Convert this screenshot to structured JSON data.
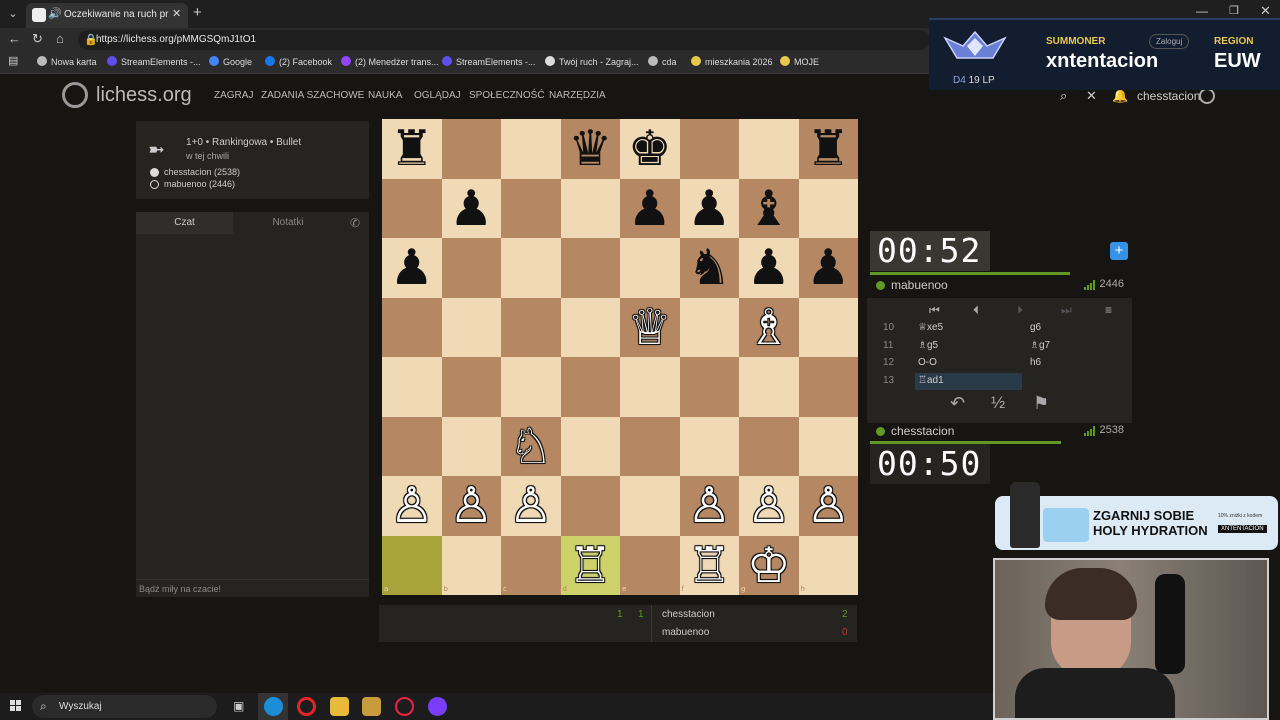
{
  "browser": {
    "tab_title": "Oczekiwanie na ruch przeciwnika",
    "url": "https://lichess.org/pMMGSQmJ1tO1",
    "bookmarks": [
      {
        "label": "Nowa karta",
        "color": "#bbbbbb"
      },
      {
        "label": "StreamElements -...",
        "color": "#5e4eeb"
      },
      {
        "label": "Google",
        "color": "#4285f4"
      },
      {
        "label": "(2) Facebook",
        "color": "#1877f2"
      },
      {
        "label": "(2) Menedżer trans...",
        "color": "#9146ff"
      },
      {
        "label": "StreamElements -...",
        "color": "#5e4eeb"
      },
      {
        "label": "Twój ruch - Zagraj...",
        "color": "#dddddd"
      },
      {
        "label": "cda",
        "color": "#bbbbbb"
      },
      {
        "label": "mieszkania 2026",
        "color": "#e8c84b"
      },
      {
        "label": "MOJE",
        "color": "#e8c84b"
      }
    ]
  },
  "site": {
    "logo": "lichess.org",
    "menu": [
      "ZAGRAJ",
      "ZADANIA SZACHOWE",
      "NAUKA",
      "OGLĄDAJ",
      "SPOŁECZNOŚĆ",
      "NARZĘDZIA"
    ],
    "username": "chesstacion"
  },
  "game_info": {
    "line1": "1+0 • Rankingowa • Bullet",
    "line2": "w tej chwili",
    "player_white": "chesstacion (2538)",
    "player_black": "mabuenoo (2446)"
  },
  "chat": {
    "tab_chat": "Czat",
    "tab_notes": "Notatki",
    "placeholder": "Bądź miły na czacie!"
  },
  "board": {
    "files": [
      "a",
      "b",
      "c",
      "d",
      "e",
      "f",
      "g",
      "h"
    ],
    "ranks": [
      "8",
      "7",
      "6",
      "5",
      "4",
      "3",
      "2",
      "1"
    ],
    "pieces": [
      {
        "sq": "a8",
        "p": "♜",
        "c": "b"
      },
      {
        "sq": "d8",
        "p": "♛",
        "c": "b"
      },
      {
        "sq": "e8",
        "p": "♚",
        "c": "b"
      },
      {
        "sq": "h8",
        "p": "♜",
        "c": "b"
      },
      {
        "sq": "b7",
        "p": "♟",
        "c": "b"
      },
      {
        "sq": "e7",
        "p": "♟",
        "c": "b"
      },
      {
        "sq": "f7",
        "p": "♟",
        "c": "b"
      },
      {
        "sq": "g7",
        "p": "♝",
        "c": "b"
      },
      {
        "sq": "a6",
        "p": "♟",
        "c": "b"
      },
      {
        "sq": "f6",
        "p": "♞",
        "c": "b"
      },
      {
        "sq": "g6",
        "p": "♟",
        "c": "b"
      },
      {
        "sq": "h6",
        "p": "♟",
        "c": "b"
      },
      {
        "sq": "e5",
        "p": "♕",
        "c": "w"
      },
      {
        "sq": "g5",
        "p": "♗",
        "c": "w"
      },
      {
        "sq": "c3",
        "p": "♘",
        "c": "w"
      },
      {
        "sq": "a2",
        "p": "♙",
        "c": "w"
      },
      {
        "sq": "b2",
        "p": "♙",
        "c": "w"
      },
      {
        "sq": "c2",
        "p": "♙",
        "c": "w"
      },
      {
        "sq": "f2",
        "p": "♙",
        "c": "w"
      },
      {
        "sq": "g2",
        "p": "♙",
        "c": "w"
      },
      {
        "sq": "h2",
        "p": "♙",
        "c": "w"
      },
      {
        "sq": "d1",
        "p": "♖",
        "c": "w"
      },
      {
        "sq": "f1",
        "p": "♖",
        "c": "w"
      },
      {
        "sq": "g1",
        "p": "♔",
        "c": "w"
      }
    ],
    "last_move": [
      "a1",
      "d1"
    ]
  },
  "opponent": {
    "clock": "00:52",
    "name": "mabuenoo",
    "rating": "2446",
    "time_fraction": 0.87
  },
  "me": {
    "clock": "00:50",
    "name": "chesstacion",
    "rating": "2538",
    "time_fraction": 0.83
  },
  "moves": [
    {
      "num": "10",
      "white": "♕xe5",
      "black": "g6"
    },
    {
      "num": "11",
      "white": "♗g5",
      "black": "♗g7"
    },
    {
      "num": "12",
      "white": "O-O",
      "black": "h6"
    },
    {
      "num": "13",
      "white": "♖ad1",
      "black": ""
    }
  ],
  "crosstable": {
    "score_a": "1",
    "score_b": "1",
    "row1_name": "chesstacion",
    "row1_score": "2",
    "row2_name": "mabuenoo",
    "row2_score": "0"
  },
  "overlay": {
    "rank_label": "D4",
    "lp": "19 LP",
    "summoner_label": "SUMMONER",
    "summoner_name": "xntentacion",
    "region_label": "REGION",
    "region": "EUW",
    "login": "Zaloguj",
    "ad_line1": "ZGARNIJ SOBIE",
    "ad_line2": "HOLY HYDRATION",
    "ad_small": "10% zniżki z kodem",
    "ad_brand": "XNTENTACION"
  },
  "taskbar": {
    "search": "Wyszukaj"
  },
  "colors": {
    "accent_green": "#629924",
    "board_light": "#f0d9b5",
    "board_dark": "#b58863",
    "highlight": "#cdd26a"
  }
}
